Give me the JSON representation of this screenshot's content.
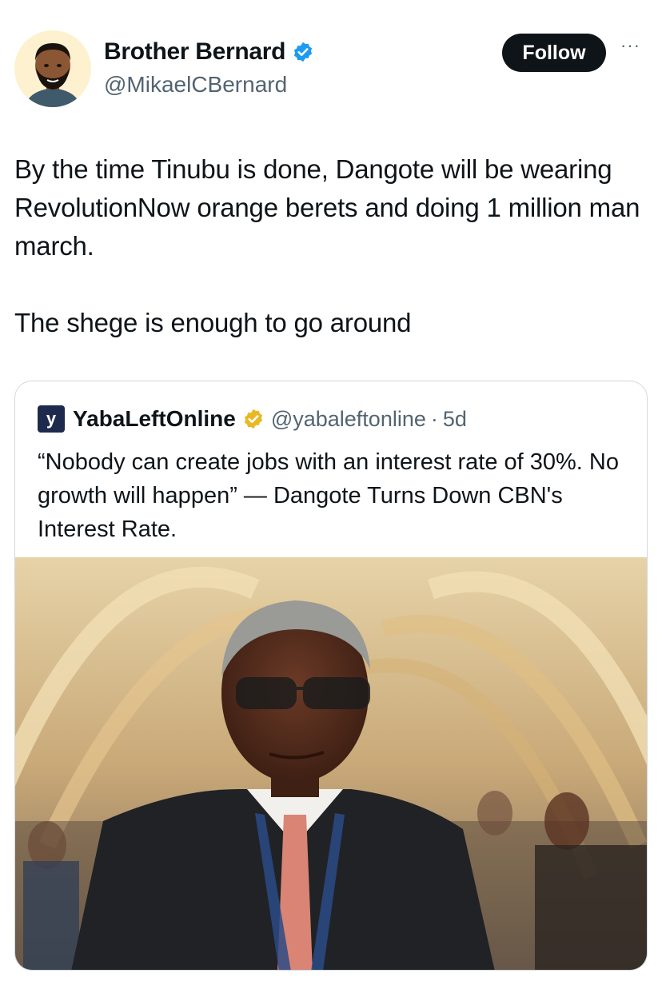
{
  "author": {
    "display_name": "Brother Bernard",
    "handle": "@MikaelCBernard",
    "verified_color": "#1d9bf0"
  },
  "follow_label": "Follow",
  "more_label": "···",
  "tweet": {
    "lines": [
      "By the time Tinubu is done, Dangote will be wearing RevolutionNow orange berets and doing 1 million man march.",
      "The shege is enough to go around"
    ]
  },
  "quoted": {
    "logo_letter": "y",
    "display_name": "YabaLeftOnline",
    "verified_color": "#e8b923",
    "handle": "@yabaleftonline",
    "separator": "·",
    "time": "5d",
    "text": "“Nobody can create jobs with an interest rate of 30%. No growth will happen” — Dangote Turns Down CBN's Interest Rate."
  },
  "icons": {
    "verified": "verified-badge-icon",
    "more": "more-options-icon"
  }
}
